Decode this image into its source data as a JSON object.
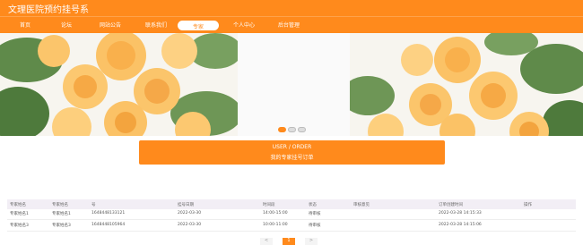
{
  "header": {
    "site_title": "文理医院预约挂号系"
  },
  "nav": {
    "items": [
      {
        "label": "首页"
      },
      {
        "label": "论坛"
      },
      {
        "label": "网站公告"
      },
      {
        "label": "联系我们"
      },
      {
        "label": "专家"
      },
      {
        "label": "个人中心"
      },
      {
        "label": "后台管理"
      }
    ],
    "active_index": 4
  },
  "banner": {
    "slide_count": 3,
    "active_slide": 1
  },
  "order_panel": {
    "title_en": "USER / ORDER",
    "title_cn": "我的专家挂号订单"
  },
  "table": {
    "columns": [
      "专家姓名",
      "专家姓名",
      "号",
      "挂号日期",
      "时间段",
      "状态",
      "审核意见",
      "订单创建时间",
      "操作"
    ],
    "rows": [
      [
        "专家姓名1",
        "专家姓名1",
        "1648448133121",
        "2022-03-30",
        "14:00-15:00",
        "待审核",
        "",
        "2022-03-28 14:15:33",
        ""
      ],
      [
        "专家姓名3",
        "专家姓名3",
        "1648448105964",
        "2022-03-30",
        "10:00-11:00",
        "待审核",
        "",
        "2022-03-28 14:15:06",
        ""
      ]
    ]
  },
  "pagination": {
    "prev": "<",
    "current": "1",
    "next": ">"
  },
  "colors": {
    "accent": "#ff8a1c",
    "header_row": "#f2eef5"
  }
}
